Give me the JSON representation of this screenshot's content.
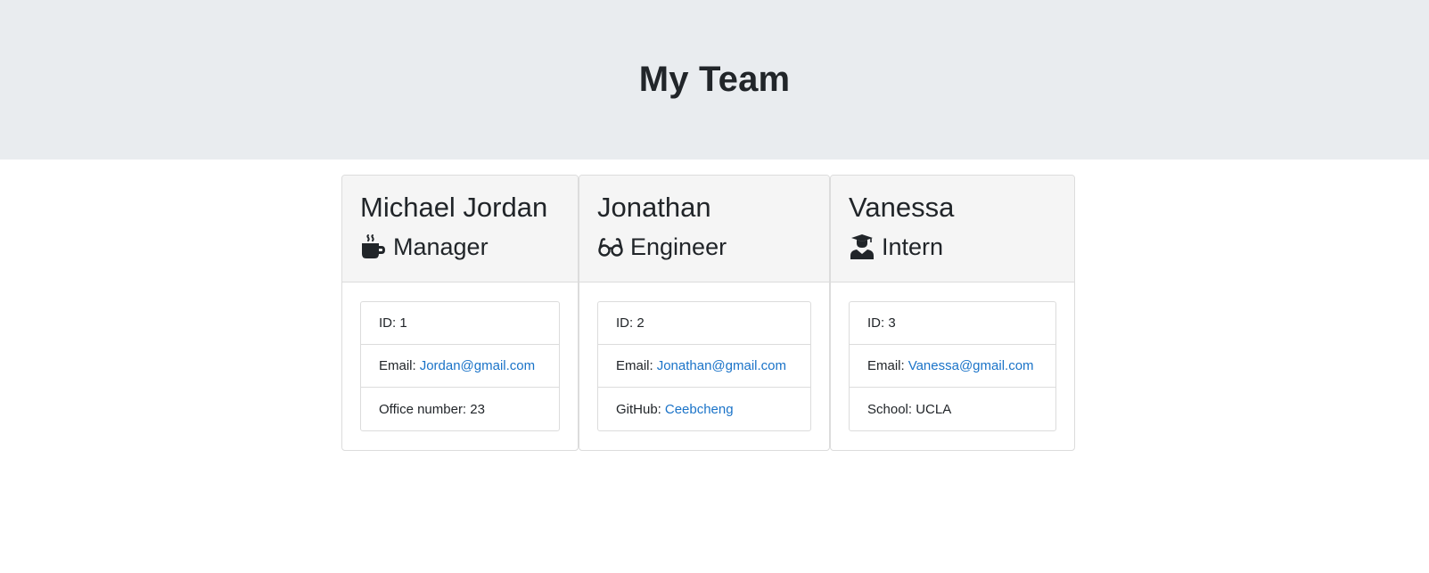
{
  "header": {
    "title": "My Team"
  },
  "cards": [
    {
      "name": "Michael Jordan",
      "role": "Manager",
      "role_icon": "mug-hot-icon",
      "items": [
        {
          "label": "ID:",
          "value": "1"
        },
        {
          "label": "Email:",
          "value": "Jordan@gmail.com"
        },
        {
          "label": "Office number:",
          "value": "23"
        }
      ]
    },
    {
      "name": "Jonathan",
      "role": "Engineer",
      "role_icon": "glasses-icon",
      "items": [
        {
          "label": "ID:",
          "value": "2"
        },
        {
          "label": "Email:",
          "value": "Jonathan@gmail.com"
        },
        {
          "label": "GitHub:",
          "value": "Ceebcheng"
        }
      ]
    },
    {
      "name": "Vanessa",
      "role": "Intern",
      "role_icon": "user-graduate-icon",
      "items": [
        {
          "label": "ID:",
          "value": "3"
        },
        {
          "label": "Email:",
          "value": "Vanessa@gmail.com"
        },
        {
          "label": "School:",
          "value": "UCLA"
        }
      ]
    }
  ],
  "colors": {
    "header_bg": "#e9ecef",
    "card_header_bg": "#f5f5f5",
    "link": "#1a73c8",
    "text": "#212529"
  }
}
